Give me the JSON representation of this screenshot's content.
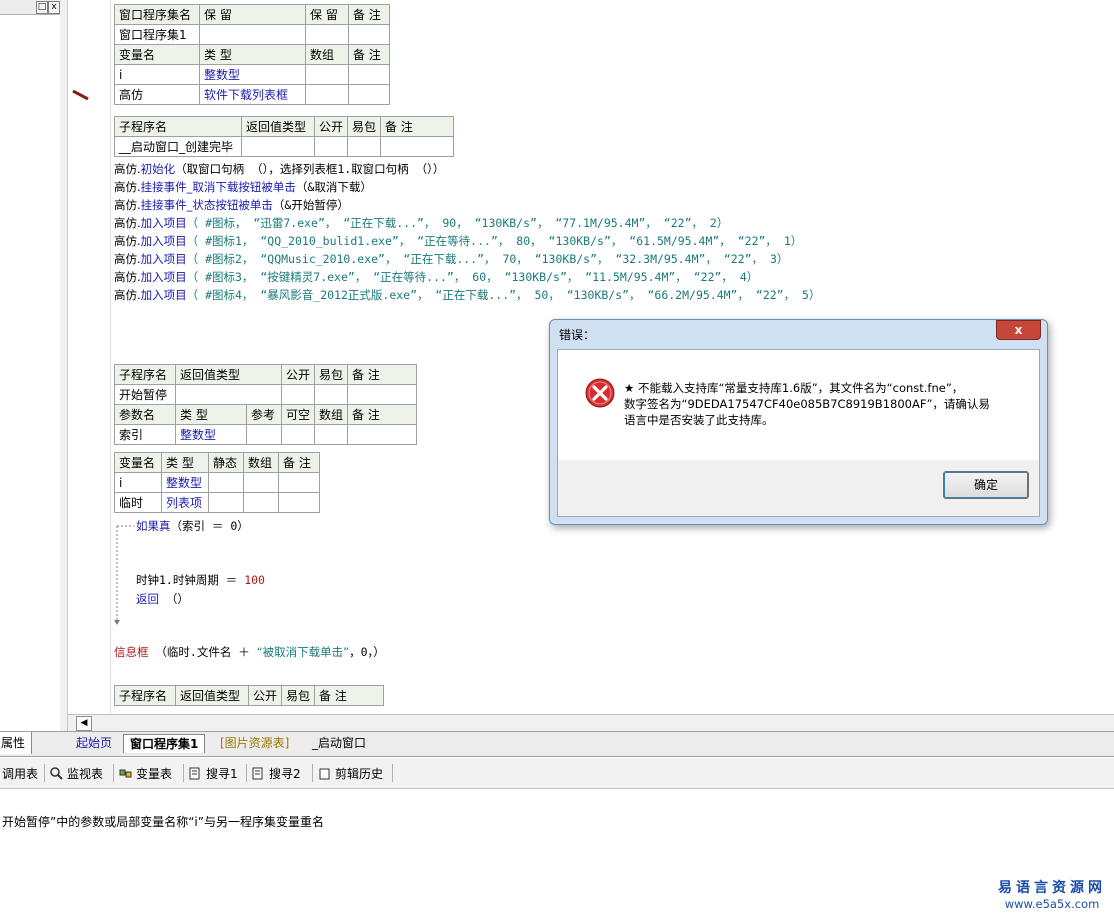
{
  "left_panel": {
    "btn_restore": "□",
    "btn_close": "x"
  },
  "class_table": {
    "header": [
      "窗口程序集名",
      "保 留",
      "保 留",
      "备 注"
    ],
    "row": [
      "窗口程序集1",
      "",
      "",
      ""
    ]
  },
  "var_table": {
    "header": [
      "变量名",
      "类 型",
      "数组",
      "备 注"
    ],
    "rows": [
      [
        "i",
        "整数型",
        "",
        ""
      ],
      [
        "高仿",
        "软件下载列表框",
        "",
        ""
      ]
    ]
  },
  "sub1_table": {
    "header": [
      "子程序名",
      "返回值类型",
      "公开",
      "易包",
      "备 注"
    ],
    "row": [
      "__启动窗口_创建完毕",
      "",
      "",
      "",
      ""
    ]
  },
  "code_lines": [
    {
      "obj": "高仿.",
      "method": "初始化",
      "args": "（取窗口句柄 （），选择列表框1.取窗口句柄 （））"
    },
    {
      "obj": "高仿.",
      "method": "挂接事件_取消下载按钮被单击",
      "args": "（&取消下载）"
    },
    {
      "obj": "高仿.",
      "method": "挂接事件_状态按钮被单击",
      "args": "（&开始暂停）"
    },
    {
      "obj": "高仿.",
      "method": "加入项目",
      "args": "（ #图标， “迅雷7.exe”， “正在下载...”， 90， “130KB/s”， “77.1M/95.4M”， “22”， 2）"
    },
    {
      "obj": "高仿.",
      "method": "加入项目",
      "args": "（ #图标1， “QQ_2010_bulid1.exe”， “正在等待...”， 80， “130KB/s”， “61.5M/95.4M”， “22”， 1）"
    },
    {
      "obj": "高仿.",
      "method": "加入项目",
      "args": "（ #图标2， “QQMusic_2010.exe”， “正在下载...”， 70， “130KB/s”， “32.3M/95.4M”， “22”， 3）"
    },
    {
      "obj": "高仿.",
      "method": "加入项目",
      "args": "（ #图标3， “按键精灵7.exe”， “正在等待...”， 60， “130KB/s”， “11.5M/95.4M”， “22”， 4）"
    },
    {
      "obj": "高仿.",
      "method": "加入项目",
      "args": "（ #图标4， “暴风影音_2012正式版.exe”， “正在下载...”， 50， “130KB/s”， “66.2M/95.4M”， “22”， 5）"
    }
  ],
  "sub2_table": {
    "header": [
      "子程序名",
      "返回值类型",
      "公开",
      "易包",
      "备 注"
    ],
    "row": [
      "开始暂停",
      "",
      "",
      "",
      ""
    ],
    "param_header": [
      "参数名",
      "类 型",
      "参考",
      "可空",
      "数组",
      "备 注"
    ],
    "param_row": [
      "索引",
      "整数型",
      "",
      "",
      "",
      ""
    ]
  },
  "local_vars": {
    "header": [
      "变量名",
      "类 型",
      "静态",
      "数组",
      "备 注"
    ],
    "rows": [
      [
        "i",
        "整数型",
        "",
        "",
        ""
      ],
      [
        "临时",
        "列表项",
        "",
        "",
        ""
      ]
    ]
  },
  "code2": {
    "if_kw": "如果真",
    "if_cond": "（索引 ＝ 0）",
    "assign_lhs": "时钟1.时钟周期 ＝ ",
    "assign_val": "100",
    "return_kw": "返回",
    "return_args": " （）",
    "msg_kw": "信息框",
    "msg_args_a": " （临时.文件名 ＋ ",
    "msg_str": "“被取消下载单击”",
    "msg_args_b": "，0，）"
  },
  "sub3_table": {
    "header": [
      "子程序名",
      "返回值类型",
      "公开",
      "易包",
      "备 注"
    ]
  },
  "tabs": {
    "properties": "属性",
    "start_page": "起始页",
    "window_assembly": "窗口程序集1",
    "image_resources": "[图片资源表]",
    "startup_window": "_启动窗口"
  },
  "toolbar": {
    "call_table": "调用表",
    "monitor": "监视表",
    "var_table": "变量表",
    "search1": "搜寻1",
    "search2": "搜寻2",
    "clip_history": "剪辑历史"
  },
  "status_message": "开始暂停”中的参数或局部变量名称“i”与另一程序集变量重名",
  "watermark": {
    "cn": "易语言资源网",
    "url": "www.e5a5x.com"
  },
  "dialog": {
    "title": "错误：",
    "close": "x",
    "message_line1": "★ 不能载入支持库“常量支持库1.6版”，其文件名为“const.fne”，",
    "message_line2": "数字签名为“9DEDA17547CF40e085B7C8919B1800AF”，请确认易",
    "message_line3": "语言中是否安装了此支持库。",
    "ok_label": "确定"
  },
  "colors": {
    "keyword_blue": "#1a1ab0",
    "string_teal": "#1a7a7a",
    "number_red": "#b01818",
    "error_red": "#d32f2f"
  }
}
